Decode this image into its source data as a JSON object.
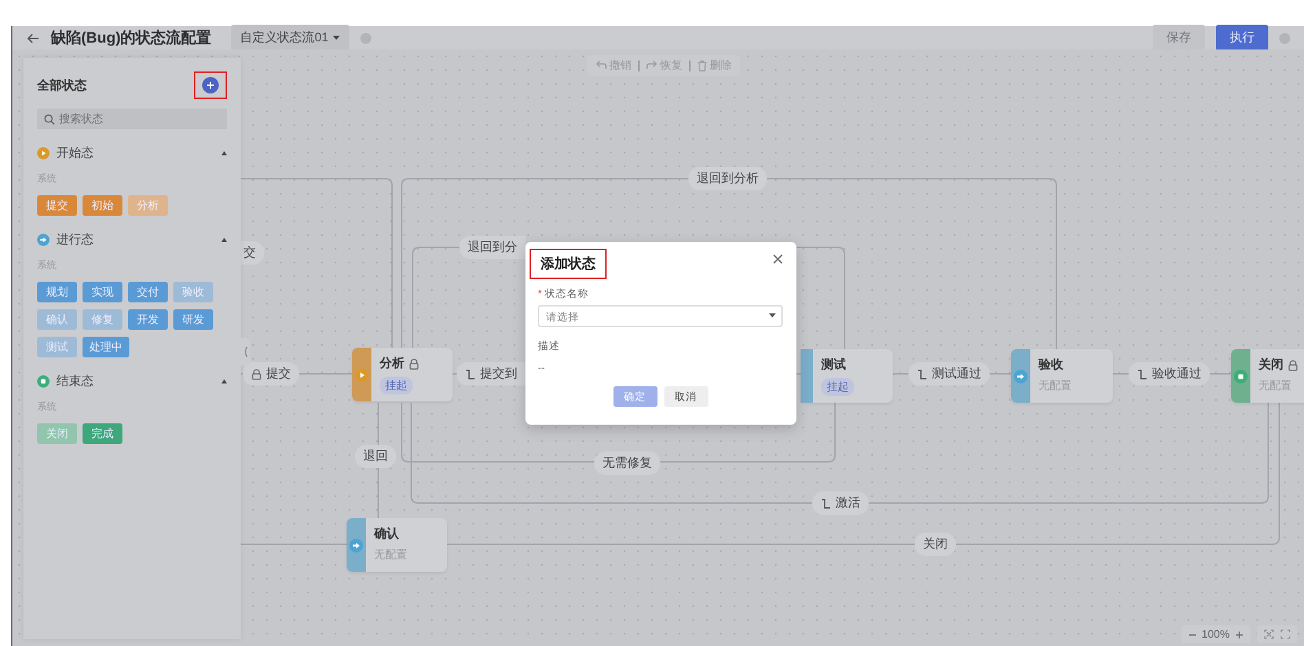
{
  "header": {
    "title": "缺陷(Bug)的状态流配置",
    "flow_select": "自定义状态流01",
    "save": {
      "label": "保存",
      "disabled": true
    },
    "execute": {
      "label": "执行",
      "disabled": false
    }
  },
  "toolbar": [
    {
      "kind": "undo",
      "label": "撤销"
    },
    {
      "kind": "redo",
      "label": "恢复"
    },
    {
      "kind": "delete",
      "label": "删除"
    }
  ],
  "panel": {
    "title": "全部状态",
    "add_highlighted": true,
    "search": {
      "placeholder": "搜索状态"
    },
    "groups": [
      {
        "kind": "start",
        "name": "开始态",
        "expanded": true,
        "section": "系统",
        "states": [
          {
            "label": "提交",
            "disabled": false
          },
          {
            "label": "初始",
            "disabled": false
          },
          {
            "label": "分析",
            "disabled": true
          }
        ]
      },
      {
        "kind": "progress",
        "name": "进行态",
        "expanded": true,
        "section": "系统",
        "states": [
          {
            "label": "规划",
            "disabled": false
          },
          {
            "label": "实现",
            "disabled": false
          },
          {
            "label": "交付",
            "disabled": false
          },
          {
            "label": "验收",
            "disabled": true
          },
          {
            "label": "确认",
            "disabled": true
          },
          {
            "label": "修复",
            "disabled": true
          },
          {
            "label": "开发",
            "disabled": false
          },
          {
            "label": "研发",
            "disabled": false
          },
          {
            "label": "测试",
            "disabled": true
          },
          {
            "label": "处理中",
            "disabled": false
          }
        ]
      },
      {
        "kind": "end",
        "name": "结束态",
        "expanded": true,
        "section": "系统",
        "states": [
          {
            "label": "关闭",
            "disabled": true
          },
          {
            "label": "完成",
            "disabled": false
          }
        ]
      }
    ]
  },
  "nodes": [
    {
      "kind": "start",
      "title": "分析",
      "locked": true,
      "tag": "挂起"
    },
    {
      "kind": "progress",
      "title": "测试",
      "locked": false,
      "tag": "挂起"
    },
    {
      "kind": "progress",
      "title": "验收",
      "locked": false,
      "note": "无配置"
    },
    {
      "kind": "end",
      "title": "关闭",
      "locked": true,
      "note": "无配置"
    },
    {
      "kind": "progress",
      "title": "确认",
      "locked": false,
      "note": "无配置"
    }
  ],
  "edges": [
    {
      "label": "退回到分析"
    },
    {
      "label": "退回到分"
    },
    {
      "label": "交"
    },
    {
      "label": "提交",
      "kind": "lock"
    },
    {
      "label": "提交到",
      "kind": "branch"
    },
    {
      "label": "测试通过",
      "kind": "branch"
    },
    {
      "label": "验收通过",
      "kind": "branch"
    },
    {
      "label": "退回"
    },
    {
      "label": "无需修复"
    },
    {
      "label": "激活",
      "kind": "branch"
    },
    {
      "label": "关闭"
    }
  ],
  "zoom": {
    "level": "100%"
  },
  "dialog": {
    "title": "添加状态",
    "title_highlighted": true,
    "field_label": "状态名称",
    "required_mark": "*",
    "placeholder": "请选择",
    "desc_label": "描述",
    "desc_value": "--",
    "confirm": {
      "label": "确定",
      "disabled": true
    },
    "cancel": {
      "label": "取消",
      "disabled": false
    }
  }
}
